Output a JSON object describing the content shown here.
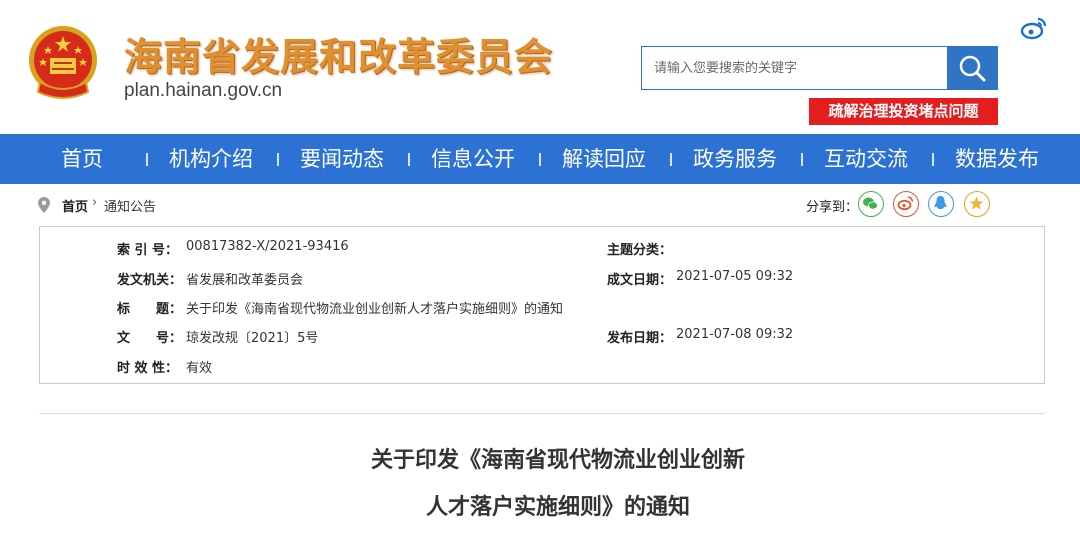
{
  "header": {
    "title": "海南省发展和改革委员会",
    "domain": "plan.hainan.gov.cn",
    "search_placeholder": "请输入您要搜索的关键字",
    "red_button_label": "疏解治理投资堵点问题",
    "icons": {
      "emblem": "national-emblem-icon",
      "weibo": "weibo-icon",
      "search": "magnifier-icon"
    }
  },
  "colors": {
    "nav_blue": "#2b72d4",
    "search_blue": "#2f74c5",
    "red": "#e41e1e",
    "title_orange": "#e0902e"
  },
  "nav": {
    "items": [
      "首页",
      "机构介绍",
      "要闻动态",
      "信息公开",
      "解读回应",
      "政务服务",
      "互动交流",
      "数据发布"
    ]
  },
  "breadcrumb": {
    "home": "首页",
    "arrow": "›",
    "current": "通知公告"
  },
  "share": {
    "label": "分享到：",
    "icons": [
      "wechat-icon",
      "weibo-icon",
      "qzone-icon",
      "favorite-icon"
    ]
  },
  "info": {
    "index_key": "索 引 号：",
    "index_val": "00817382-X/2021-93416",
    "topic_key": "主题分类：",
    "topic_val": "",
    "issuer_key": "发文机关：",
    "issuer_val": "省发展和改革委员会",
    "date_made_key": "成文日期：",
    "date_made_val": "2021-07-05 09:32",
    "title_key": "标　　题：",
    "title_val": "关于印发《海南省现代物流业创业创新人才落户实施细则》的通知",
    "docno_key": "文　　号：",
    "docno_val": "琼发改规〔2021〕5号",
    "date_pub_key": "发布日期：",
    "date_pub_val": "2021-07-08 09:32",
    "validity_key": "时 效 性：",
    "validity_val": "有效"
  },
  "article": {
    "title_line1": "关于印发《海南省现代物流业创业创新",
    "title_line2": "人才落户实施细则》的通知"
  }
}
